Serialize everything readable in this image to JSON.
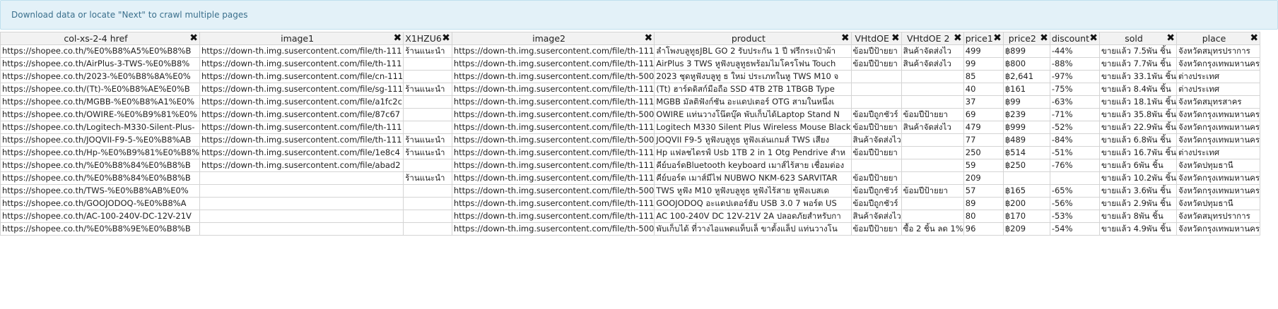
{
  "banner": {
    "text": "Download data or locate \"Next\" to crawl multiple pages"
  },
  "columns": [
    "col-xs-2-4 href",
    "image1",
    "X1HZU6",
    "image2",
    "product",
    "VHtdOE",
    "VHtdOE 2",
    "price1",
    "price2",
    "discount",
    "sold",
    "place"
  ],
  "rows": [
    [
      "https://shopee.co.th/%E0%B8%A5%E0%B8%B",
      "https://down-th.img.susercontent.com/file/th-111",
      "ร้านแนะนำ",
      "https://down-th.img.susercontent.com/file/th-111",
      "ลำโพงบลูทูธJBL GO 2 รับประกัน 1 ปี ฟรีกระเป๋าผ้า",
      "ข้อมปีป้ายยา",
      "สินค้าจัดส่งไว",
      "499",
      "฿899",
      "-44%",
      "ขายแล้ว 7.5พัน ชิ้น",
      "จังหวัดสมุทรปราการ"
    ],
    [
      "https://shopee.co.th/AirPlus-3-TWS-%E0%B8%",
      "https://down-th.img.susercontent.com/file/th-111",
      "",
      "https://down-th.img.susercontent.com/file/th-111",
      "AirPlus 3 TWS หูฟังบลูทูธพร้อมไมโครโฟน Touch",
      "ข้อมปีป้ายยา",
      "สินค้าจัดส่งไว",
      "99",
      "฿800",
      "-88%",
      "ขายแล้ว 7.7พัน ชิ้น",
      "จังหวัดกรุงเทพมหานคร"
    ],
    [
      "https://shopee.co.th/2023-%E0%B8%8A%E0%",
      "https://down-th.img.susercontent.com/file/cn-111",
      "",
      "https://down-th.img.susercontent.com/file/th-500",
      "2023 ชุดหูฟังบลูทู ธ ใหม่ ประเภทในหู TWS M10 จ",
      "",
      "",
      "85",
      "฿2,641",
      "-97%",
      "ขายแล้ว 33.1พัน ชิ้น",
      "ต่างประเทศ"
    ],
    [
      "https://shopee.co.th/(Tt)-%E0%B8%AE%E0%B",
      "https://down-th.img.susercontent.com/file/sg-111",
      "ร้านแนะนำ",
      "https://down-th.img.susercontent.com/file/th-111",
      "(Tt) ฮาร์ดดิสก์มือถือ SSD 4TB 2TB 1TBGB Type",
      "",
      "",
      "40",
      "฿161",
      "-75%",
      "ขายแล้ว 8.4พัน ชิ้น",
      "ต่างประเทศ"
    ],
    [
      "https://shopee.co.th/MGBB-%E0%B8%A1%E0%",
      "https://down-th.img.susercontent.com/file/a1fc2c",
      "",
      "https://down-th.img.susercontent.com/file/th-111",
      "MGBB มัลติฟังก์ชัน อะแดปเตอร์ OTG สามในหนึ่งเ",
      "",
      "",
      "37",
      "฿99",
      "-63%",
      "ขายแล้ว 18.1พัน ชิ้น",
      "จังหวัดสมุทรสาคร"
    ],
    [
      "https://shopee.co.th/OWIRE-%E0%B9%81%E0%",
      "https://down-th.img.susercontent.com/file/87c67",
      "",
      "https://down-th.img.susercontent.com/file/th-500",
      "OWIRE แท่นวางโน๊ตบุ๊ค พับเก็บได้Laptop Stand N",
      "ข้อมปีถูกชัวร์",
      "ข้อมปีป้ายยา",
      "69",
      "฿239",
      "-71%",
      "ขายแล้ว 35.8พัน ชิ้น",
      "จังหวัดกรุงเทพมหานคร"
    ],
    [
      "https://shopee.co.th/Logitech-M330-Silent-Plus-",
      "https://down-th.img.susercontent.com/file/th-111",
      "",
      "https://down-th.img.susercontent.com/file/th-111",
      "Logitech M330 Silent Plus Wireless Mouse Black",
      "ข้อมปีป้ายยา",
      "สินค้าจัดส่งไว",
      "479",
      "฿999",
      "-52%",
      "ขายแล้ว 22.9พัน ชิ้น",
      "จังหวัดกรุงเทพมหานคร"
    ],
    [
      "https://shopee.co.th/JOQVII-F9-5-%E0%B8%AB",
      "https://down-th.img.susercontent.com/file/th-111",
      "ร้านแนะนำ",
      "https://down-th.img.susercontent.com/file/th-500",
      "JOQVII F9-5 หูฟังบลูทูธ หูฟังเล่นเกมส์ TWS เสียง",
      "สินค้าจัดส่งไว",
      "",
      "77",
      "฿489",
      "-84%",
      "ขายแล้ว 6.8พัน ชิ้น",
      "จังหวัดกรุงเทพมหานคร"
    ],
    [
      "https://shopee.co.th/Hp-%E0%B9%81%E0%B8%",
      "https://down-th.img.susercontent.com/file/1e8c4",
      "ร้านแนะนำ",
      "https://down-th.img.susercontent.com/file/th-111",
      "Hp แฟลชไดรฟ์ Usb 1TB 2 in 1 Otg Pendrive สำห",
      "ข้อมปีป้ายยา",
      "",
      "250",
      "฿514",
      "-51%",
      "ขายแล้ว 16.7พัน ชิ้น",
      "ต่างประเทศ"
    ],
    [
      "https://shopee.co.th/%E0%B8%84%E0%B8%B",
      "https://down-th.img.susercontent.com/file/abad2",
      "",
      "https://down-th.img.susercontent.com/file/th-111",
      "คีย์บอร์ดBluetooth keyboard เมาส์ไร้สาย เชื่อมต่อง",
      "",
      "",
      "59",
      "฿250",
      "-76%",
      "ขายแล้ว 6พัน ชิ้น",
      "จังหวัดปทุมธานี"
    ],
    [
      "https://shopee.co.th/%E0%B8%84%E0%B8%B",
      "",
      "ร้านแนะนำ",
      "https://down-th.img.susercontent.com/file/th-111",
      "คีย์บอร์ด เมาส์มีไฟ NUBWO NKM-623 SARVITAR",
      "ข้อมปีป้ายยา",
      "",
      "209",
      "",
      "",
      "ขายแล้ว 10.2พัน ชิ้น",
      "จังหวัดกรุงเทพมหานคร"
    ],
    [
      "https://shopee.co.th/TWS-%E0%B8%AB%E0%",
      "",
      "",
      "https://down-th.img.susercontent.com/file/th-500",
      "TWS หูฟัง M10 หูฟังบลูทูธ หูฟังไร้สาย หูฟังเบสเด",
      "ข้อมปีถูกชัวร์",
      "ข้อมปีป้ายยา",
      "57",
      "฿165",
      "-65%",
      "ขายแล้ว 3.6พัน ชิ้น",
      "จังหวัดกรุงเทพมหานคร"
    ],
    [
      "https://shopee.co.th/GOOJODOQ-%E0%B8%A",
      "",
      "",
      "https://down-th.img.susercontent.com/file/th-111",
      "GOOJODOQ อะแดปเตอร์ฮับ USB 3.0 7 พอร์ต US",
      "ข้อมปีถูกชัวร์",
      "",
      "89",
      "฿200",
      "-56%",
      "ขายแล้ว 2.9พัน ชิ้น",
      "จังหวัดปทุมธานี"
    ],
    [
      "https://shopee.co.th/AC-100-240V-DC-12V-21V",
      "",
      "",
      "https://down-th.img.susercontent.com/file/th-111",
      "AC 100-240V DC 12V-21V 2A ปลอดภัยสำหรับกา",
      "สินค้าจัดส่งไว",
      "",
      "80",
      "฿170",
      "-53%",
      "ขายแล้ว 8พัน ชิ้น",
      "จังหวัดสมุทรปราการ"
    ],
    [
      "https://shopee.co.th/%E0%B8%9E%E0%B8%B",
      "",
      "",
      "https://down-th.img.susercontent.com/file/th-500",
      "พับเก็บได้ ที่วางไอแพดแท็บเล็ ขาตั้งแล็ป แท่นวางโน",
      "ข้อมปีป้ายยา",
      "ซื้อ 2 ชิ้น ลด 1%",
      "96",
      "฿209",
      "-54%",
      "ขายแล้ว 4.9พัน ชิ้น",
      "จังหวัดกรุงเทพมหานคร"
    ]
  ]
}
